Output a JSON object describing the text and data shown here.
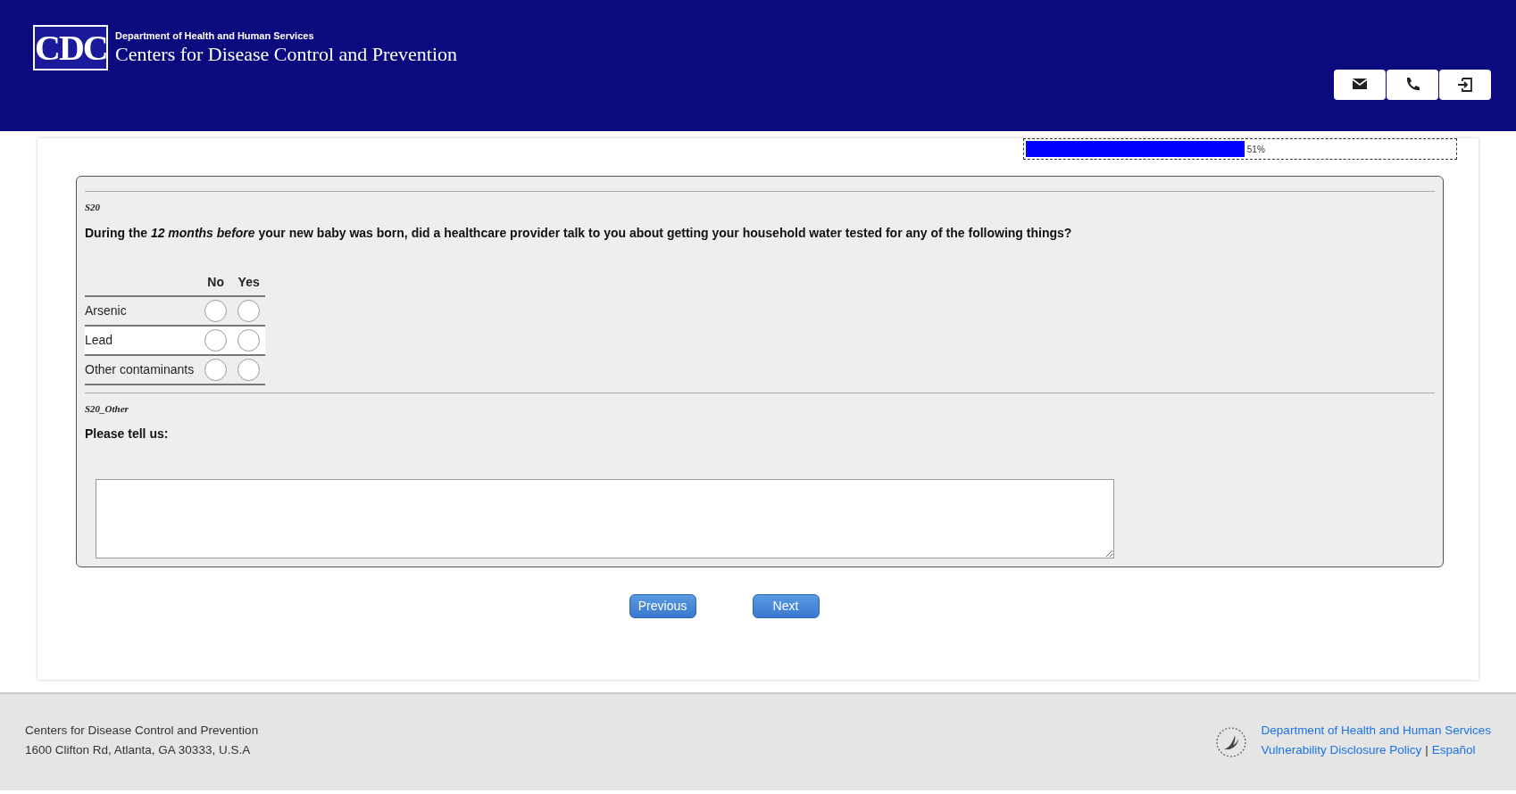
{
  "header": {
    "agency_parent": "Department of Health and Human Services",
    "agency_name": "Centers for Disease Control and Prevention",
    "logo_text": "CDC",
    "buttons": [
      {
        "kind": "email"
      },
      {
        "kind": "phone"
      },
      {
        "kind": "exit"
      }
    ]
  },
  "progress": {
    "level": 0.51,
    "reading": "51%"
  },
  "questions": [
    {
      "kind": "matrix",
      "code": "S20",
      "text": "During the *12 months before* your new baby was born, did a healthcare provider talk to you about getting your household water tested for any of the following things?",
      "columns": [
        "No",
        "Yes"
      ],
      "rows": [
        {
          "label": "Arsenic",
          "highlighted": false,
          "choices": [
            {
              "selected": false
            },
            {
              "selected": false
            }
          ]
        },
        {
          "label": "Lead",
          "highlighted": true,
          "choices": [
            {
              "selected": false
            },
            {
              "selected": false
            }
          ]
        },
        {
          "label": "Other contaminants",
          "highlighted": false,
          "choices": [
            {
              "selected": false
            },
            {
              "selected": false
            }
          ]
        }
      ]
    },
    {
      "kind": "text",
      "code": "S20_Other",
      "text": "Please tell us:"
    }
  ],
  "nav_buttons": [
    "Previous",
    "Next"
  ],
  "footer": {
    "address": [
      "Centers for Disease Control and Prevention",
      "1600 Clifton Rd, Atlanta, GA 30333, U.S.A"
    ],
    "links": [
      "Department of Health and Human Services",
      "Vulnerability Disclosure Policy",
      "Español"
    ],
    "separator": "|"
  }
}
